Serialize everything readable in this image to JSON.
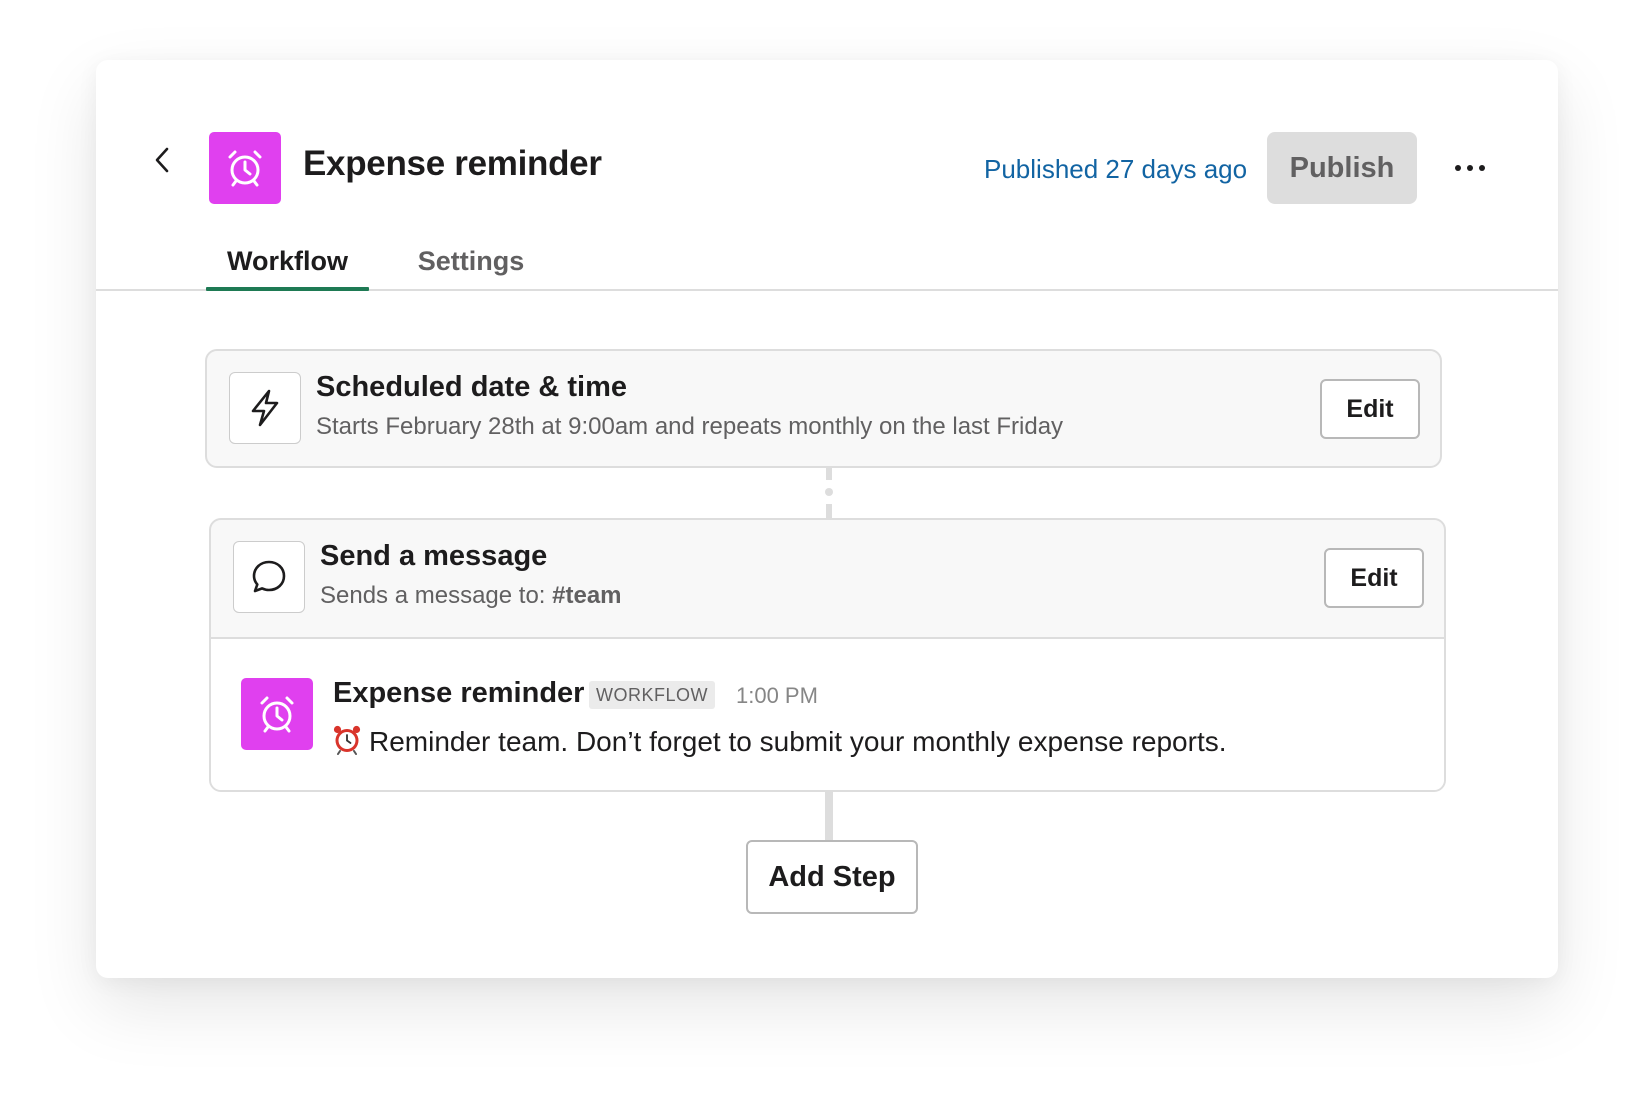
{
  "header": {
    "title": "Expense reminder",
    "published_status": "Published 27 days ago",
    "publish_label": "Publish",
    "app_icon": "alarm-clock-icon",
    "app_icon_color": "#e040ef"
  },
  "tabs": [
    {
      "label": "Workflow",
      "active": true
    },
    {
      "label": "Settings",
      "active": false
    }
  ],
  "steps": [
    {
      "icon": "lightning-bolt-icon",
      "title": "Scheduled date & time",
      "subtitle": "Starts February 28th at 9:00am and repeats monthly on the last Friday",
      "edit_label": "Edit"
    },
    {
      "icon": "speech-bubble-icon",
      "title": "Send a message",
      "subtitle_prefix": "Sends a message to: ",
      "subtitle_channel": "#team",
      "edit_label": "Edit",
      "preview": {
        "sender": "Expense reminder",
        "badge": "WORKFLOW",
        "time": "1:00 PM",
        "emoji": "alarm-clock-emoji",
        "text": "Reminder team. Don’t forget to submit your monthly expense reports."
      }
    }
  ],
  "add_step_label": "Add Step",
  "colors": {
    "accent_green": "#1e7a54",
    "link_blue": "#1264a3",
    "brand_magenta": "#e040ef"
  }
}
